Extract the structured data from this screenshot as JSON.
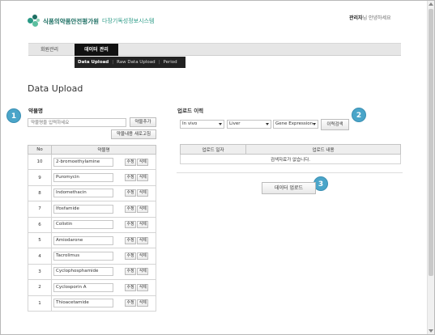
{
  "header": {
    "logo_main": "식품의약품안전평가원",
    "logo_sub": "다장기독성정보시스템",
    "user_name": "관리자",
    "user_greeting": "님 안녕하세요"
  },
  "menu": {
    "items": [
      {
        "label": "회원관리"
      },
      {
        "label": "데이터 관리"
      }
    ],
    "sub_items": [
      {
        "label": "Data Upload"
      },
      {
        "label": "Raw Data Upload"
      },
      {
        "label": "Period"
      }
    ]
  },
  "page": {
    "title": "Data Upload"
  },
  "badges": [
    "1",
    "2",
    "3"
  ],
  "drug_panel": {
    "label": "약물명",
    "search_placeholder": "약물명을 입력하세요",
    "add_button": "약물추가",
    "refresh_button": "약물내용 새로고침",
    "columns": [
      "No",
      "약물명"
    ],
    "edit_label": "수정",
    "delete_label": "삭제",
    "rows": [
      {
        "no": "10",
        "name": "2-bromoethylamine"
      },
      {
        "no": "9",
        "name": "Puromycin"
      },
      {
        "no": "8",
        "name": "Indomethacin"
      },
      {
        "no": "7",
        "name": "Ifosfamide"
      },
      {
        "no": "6",
        "name": "Colistin"
      },
      {
        "no": "5",
        "name": "Amiodarone"
      },
      {
        "no": "4",
        "name": "Tacrolimus"
      },
      {
        "no": "3",
        "name": "Cyclophosphamide"
      },
      {
        "no": "2",
        "name": "Cyclosporin A"
      },
      {
        "no": "1",
        "name": "Thioacetamide"
      }
    ]
  },
  "upload_panel": {
    "label": "업로드 이력",
    "select_1": "In vivo",
    "select_2": "Liver",
    "select_3": "Gene Expression",
    "search_button": "이력검색",
    "columns": [
      "업로드 일자",
      "업로드 내용"
    ],
    "empty_message": "검색자료가 없습니다.",
    "upload_button": "데이터 업로드"
  },
  "colors": {
    "badge": "#4aa5c9",
    "logo_green": "#1d6f63",
    "menu_active": "#111111"
  }
}
